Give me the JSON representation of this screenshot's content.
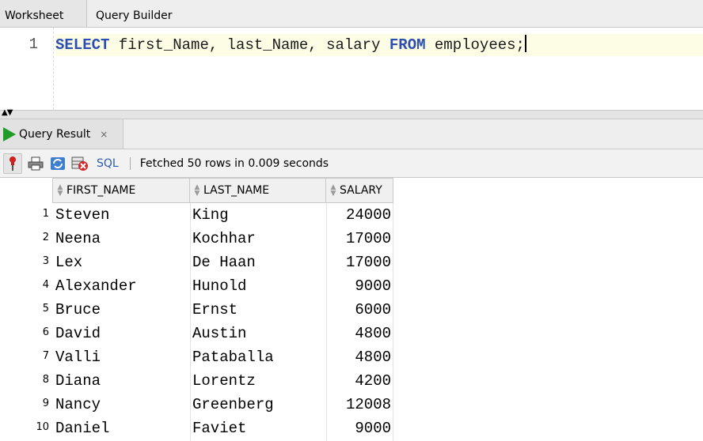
{
  "editor_tabs": [
    {
      "label": "Worksheet",
      "active": true
    },
    {
      "label": "Query Builder",
      "active": false
    }
  ],
  "editor": {
    "line_number": "1",
    "sql_keyword_select": "SELECT",
    "sql_columns": " first_Name, last_Name, salary ",
    "sql_keyword_from": "FROM",
    "sql_table": " employees;"
  },
  "result_tab": {
    "label": "Query Result",
    "close": "×"
  },
  "toolbar": {
    "sql_label": "SQL",
    "status": "Fetched 50 rows in 0.009 seconds"
  },
  "grid": {
    "columns": [
      "FIRST_NAME",
      "LAST_NAME",
      "SALARY"
    ],
    "rows": [
      {
        "n": "1",
        "first": "Steven",
        "last": "King",
        "salary": "24000"
      },
      {
        "n": "2",
        "first": "Neena",
        "last": "Kochhar",
        "salary": "17000"
      },
      {
        "n": "3",
        "first": "Lex",
        "last": "De Haan",
        "salary": "17000"
      },
      {
        "n": "4",
        "first": "Alexander",
        "last": "Hunold",
        "salary": "9000"
      },
      {
        "n": "5",
        "first": "Bruce",
        "last": "Ernst",
        "salary": "6000"
      },
      {
        "n": "6",
        "first": "David",
        "last": "Austin",
        "salary": "4800"
      },
      {
        "n": "7",
        "first": "Valli",
        "last": "Pataballa",
        "salary": "4800"
      },
      {
        "n": "8",
        "first": "Diana",
        "last": "Lorentz",
        "salary": "4200"
      },
      {
        "n": "9",
        "first": "Nancy",
        "last": "Greenberg",
        "salary": "12008"
      },
      {
        "n": "10",
        "first": "Daniel",
        "last": "Faviet",
        "salary": "9000"
      }
    ]
  },
  "colors": {
    "keyword": "#2a4fb0",
    "run_icon": "#1f9b27",
    "current_line": "#fdfde6",
    "sql_link": "#2a5bb0"
  },
  "icons": [
    "play-icon",
    "pin-icon",
    "print-icon",
    "refresh-icon",
    "delete-icon",
    "sort-icon",
    "close-icon"
  ]
}
